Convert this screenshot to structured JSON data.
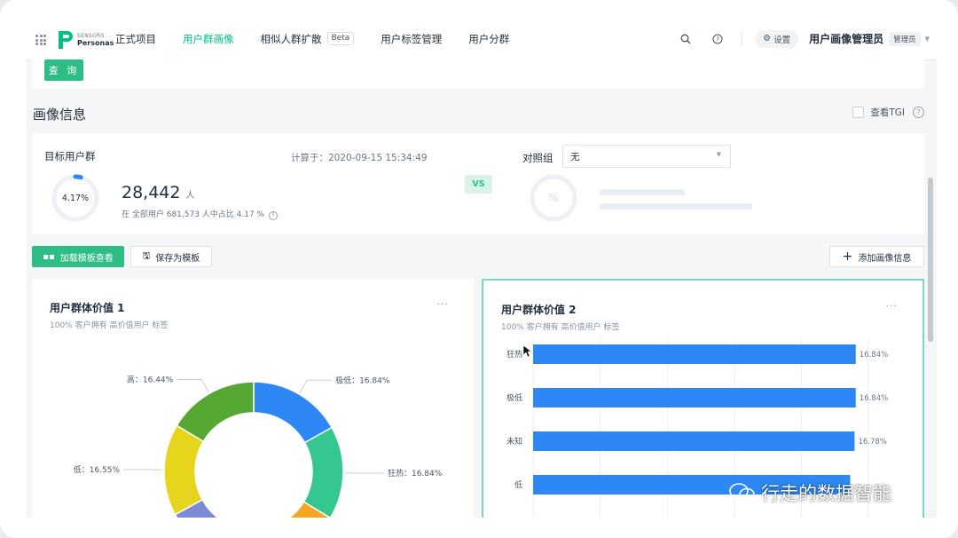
{
  "brand": {
    "line1": "SENSORS",
    "line2": "Personas",
    "color": "#00bf8a"
  },
  "nav": [
    {
      "label": "正式项目",
      "active": false
    },
    {
      "label": "用户群画像",
      "active": true
    },
    {
      "label": "相似人群扩散",
      "active": false,
      "badge": "Beta"
    },
    {
      "label": "用户标签管理",
      "active": false
    },
    {
      "label": "用户分群",
      "active": false
    }
  ],
  "header": {
    "settings_label": "设置",
    "user_name": "用户画像管理员",
    "role": "管理员"
  },
  "query": {
    "button_label": "查 询"
  },
  "section": {
    "title": "画像信息",
    "tgi_label": "查看TGI"
  },
  "summary": {
    "target_label": "目标用户群",
    "calc_time": "计算于：2020-09-15 15:34:49",
    "percent_text": "4.17%",
    "percent_value": 4.17,
    "count": "28,442",
    "count_unit": "人",
    "share_text": "在 全部用户 681,573 人中占比 4.17 %",
    "vs": "VS",
    "compare_label": "对照组",
    "compare_value": "无",
    "placeholder_ring_text": "%"
  },
  "toolbar": {
    "load_template": "加载模板查看",
    "save_template": "保存为模板",
    "add_profile": "添加画像信息"
  },
  "cards": [
    {
      "title": "用户群体价值 1",
      "subtitle": "100% 客户拥有 高价值用户 标签",
      "more": "···"
    },
    {
      "title": "用户群体价值 2",
      "subtitle": "100% 客户拥有 高价值用户 标签",
      "more": "···"
    }
  ],
  "watermark": "行走的数据智能",
  "colors": {
    "accent": "#2ebd85",
    "blue": "#2d87f5",
    "teal": "#34c78f",
    "orange": "#f5a623",
    "yellow": "#e6d51c",
    "green": "#57a832",
    "purple": "#7d8bd6"
  },
  "chart_data": [
    {
      "type": "pie",
      "donut": true,
      "visible_labels": [
        {
          "text": "极低：16.84%"
        },
        {
          "text": "狂热：16.84%"
        },
        {
          "text": "低：16.55%"
        },
        {
          "text": "高：16.44%"
        }
      ],
      "slices": [
        {
          "name": "极低",
          "value": 16.84,
          "color": "#2d87f5"
        },
        {
          "name": "狂热",
          "value": 16.84,
          "color": "#34c78f"
        },
        {
          "name": "",
          "value": 16.8,
          "color": "#f5a623"
        },
        {
          "name": "",
          "value": 16.5,
          "color": "#7d8bd6"
        },
        {
          "name": "低",
          "value": 16.55,
          "color": "#e6d51c"
        },
        {
          "name": "高",
          "value": 16.44,
          "color": "#57a832"
        }
      ]
    },
    {
      "type": "bar",
      "orientation": "horizontal",
      "categories": [
        "狂热",
        "极低",
        "未知",
        "低"
      ],
      "values": [
        16.84,
        16.84,
        16.78,
        16.55
      ],
      "labels": [
        "16.84%",
        "16.84%",
        "16.78%",
        ""
      ],
      "xlim": [
        0,
        17.5
      ],
      "color": "#2d87f5",
      "grid": true
    }
  ]
}
